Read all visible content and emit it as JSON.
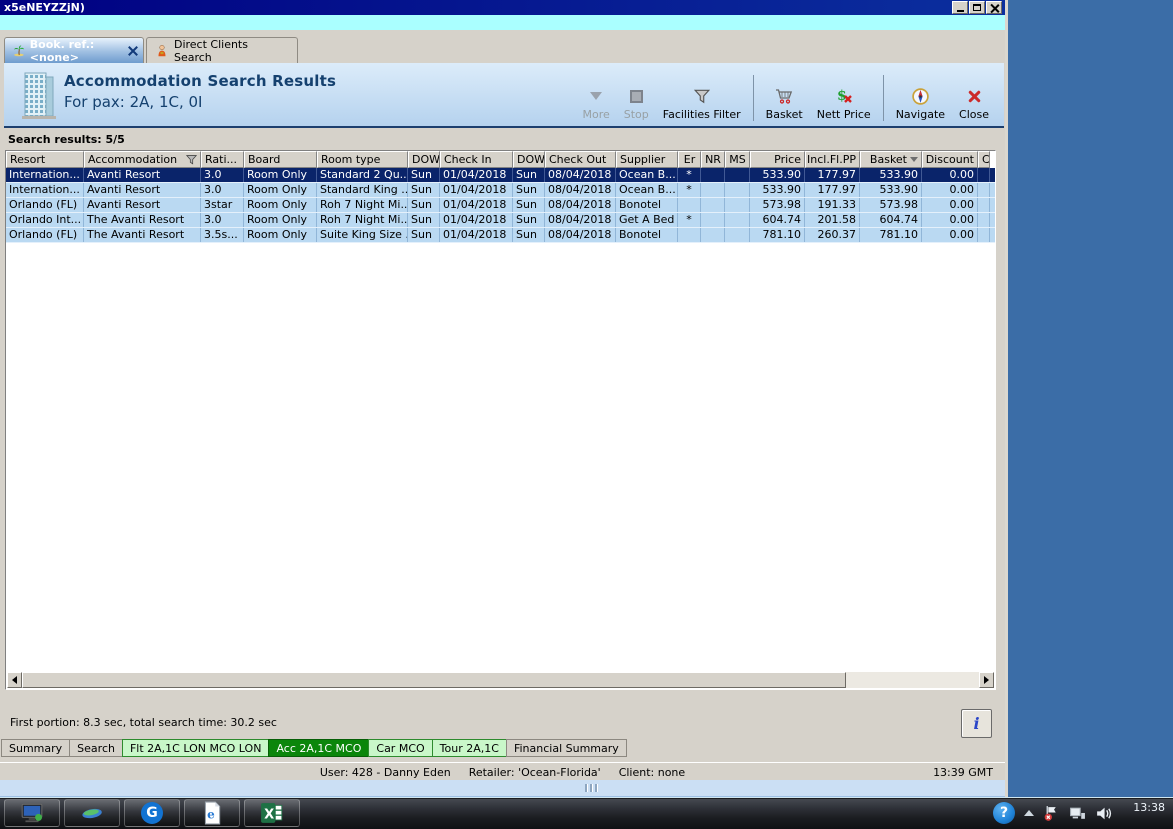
{
  "window": {
    "title": "x5eNEYZZjN)"
  },
  "doc_tabs": [
    {
      "label": "Book. ref.: <none>",
      "icon": "palm-tree-icon",
      "active": true
    },
    {
      "label": "Direct Clients Search",
      "icon": "person-icon",
      "active": false
    }
  ],
  "header": {
    "title": "Accommodation Search Results",
    "subtitle": "For pax: 2A, 1C, 0I"
  },
  "toolbar": {
    "more": "More",
    "stop": "Stop",
    "facilities_filter": "Facilities Filter",
    "basket": "Basket",
    "nett_price": "Nett Price",
    "navigate": "Navigate",
    "close": "Close"
  },
  "results": {
    "summary": "Search results: 5/5",
    "columns": [
      "Resort",
      "Accommodation",
      "Rati...",
      "Board",
      "Room type",
      "DOW",
      "Check In",
      "DOW",
      "Check Out",
      "Supplier",
      "Er",
      "NR",
      "MS",
      "Price",
      "Incl.Fl.PP",
      "Basket",
      "Discount",
      "C"
    ],
    "selected_row_index": 0,
    "rows": [
      [
        "Internation...",
        "Avanti Resort",
        "3.0",
        "Room Only",
        "Standard 2 Qu...",
        "Sun",
        "01/04/2018",
        "Sun",
        "08/04/2018",
        "Ocean B...",
        "*",
        "",
        "",
        "533.90",
        "177.97",
        "533.90",
        "0.00",
        ""
      ],
      [
        "Internation...",
        "Avanti Resort",
        "3.0",
        "Room Only",
        "Standard King ...",
        "Sun",
        "01/04/2018",
        "Sun",
        "08/04/2018",
        "Ocean B...",
        "*",
        "",
        "",
        "533.90",
        "177.97",
        "533.90",
        "0.00",
        ""
      ],
      [
        "Orlando (FL)",
        "Avanti Resort",
        "3star",
        "Room Only",
        "Roh 7 Night Mi...",
        "Sun",
        "01/04/2018",
        "Sun",
        "08/04/2018",
        "Bonotel",
        "",
        "",
        "",
        "573.98",
        "191.33",
        "573.98",
        "0.00",
        ""
      ],
      [
        "Orlando Int...",
        "The Avanti Resort",
        "3.0",
        "Room Only",
        "Roh 7 Night Mi...",
        "Sun",
        "01/04/2018",
        "Sun",
        "08/04/2018",
        "Get A Bed",
        "*",
        "",
        "",
        "604.74",
        "201.58",
        "604.74",
        "0.00",
        ""
      ],
      [
        "Orlando (FL)",
        "The Avanti Resort",
        "3.5s...",
        "Room Only",
        "Suite King Size ...",
        "Sun",
        "01/04/2018",
        "Sun",
        "08/04/2018",
        "Bonotel",
        "",
        "",
        "",
        "781.10",
        "260.37",
        "781.10",
        "0.00",
        ""
      ]
    ]
  },
  "footer": {
    "status_line": "First portion: 8.3 sec, total search time: 30.2 sec",
    "info_button": "i"
  },
  "bottom_tabs": [
    {
      "label": "Summary"
    },
    {
      "label": "Search"
    },
    {
      "label": "Flt 2A,1C LON MCO LON"
    },
    {
      "label": "Acc 2A,1C MCO"
    },
    {
      "label": "Car MCO"
    },
    {
      "label": "Tour 2A,1C"
    },
    {
      "label": "Financial Summary"
    }
  ],
  "status_bar": {
    "user": "User: 428 - Danny Eden",
    "retailer": "Retailer: 'Ocean-Florida'",
    "client": "Client: none",
    "time": "13:39 GMT"
  },
  "taskbar": {
    "clock": "13:38"
  },
  "colors": {
    "desktop": "#3B6DA7",
    "titlebar": "#000082",
    "cyan_strip": "#AAFFFF",
    "selected_row": "#0A246A",
    "row_blue": "#BAD9F2",
    "tab_active_green": "#0B860B",
    "tab_light_green": "#C9F7C9",
    "header_text": "#15416F"
  }
}
